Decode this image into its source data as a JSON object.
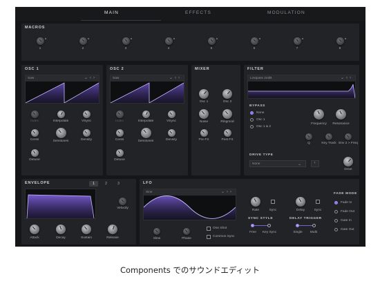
{
  "tabs": [
    "MAIN",
    "EFFECTS",
    "MODULATION"
  ],
  "macros": {
    "title": "MACROS",
    "labels": [
      "1",
      "2",
      "3",
      "4",
      "5",
      "6",
      "7",
      "8"
    ]
  },
  "osc1": {
    "title": "OSC 1",
    "wave": "Saw",
    "knobs": [
      "Index",
      "Interpolate",
      "VSync",
      "Cents",
      "Semitones",
      "Density",
      "Detune"
    ]
  },
  "osc2": {
    "title": "OSC 2",
    "wave": "Saw",
    "knobs": [
      "Index",
      "Interpolate",
      "VSync",
      "Cents",
      "Semitones",
      "Density",
      "Detune"
    ]
  },
  "mixer": {
    "title": "MIXER",
    "knobs": [
      "Osc 1",
      "Osc 2",
      "Noise",
      "Ringmod",
      "Pre FX",
      "Post FX"
    ]
  },
  "filter": {
    "title": "FILTER",
    "type": "Lowpass 24dB",
    "bypass_title": "BYPASS",
    "bypass_options": [
      "None",
      "Osc 1",
      "Osc 1 & 2"
    ],
    "knobs": [
      "Frequency",
      "Resonance",
      "Q",
      "Key Track",
      "Env 2 > Freq"
    ],
    "drive_title": "DRIVE TYPE",
    "drive_value": "None",
    "drive_knob": "Drive"
  },
  "envelope": {
    "title": "ENVELOPE",
    "pages": [
      "1",
      "2",
      "3"
    ],
    "velocity": "Velocity",
    "knobs": [
      "Attack",
      "Decay",
      "Sustain",
      "Release"
    ]
  },
  "lfo": {
    "title": "LFO",
    "wave": "Sine",
    "knobs": [
      "Slew",
      "Phase"
    ],
    "checks": [
      "One Shot",
      "Common Sync"
    ],
    "rate": "Rate",
    "sync": "Sync",
    "delay": "Delay",
    "sync2": "Sync",
    "sync_style_title": "SYNC STYLE",
    "sync_style": [
      "Free",
      "Key Sync"
    ],
    "delay_trigger_title": "DELAY TRIGGER",
    "delay_trigger": [
      "Single",
      "Multi"
    ],
    "fade_title": "FADE MODE",
    "fade_options": [
      "Fade In",
      "Fade Out",
      "Gate In",
      "Gate Out"
    ]
  },
  "caption": "Components でのサウンドエディット",
  "colors": {
    "accent": "#7a5ed6",
    "bg": "#151618",
    "panel": "#222326"
  }
}
